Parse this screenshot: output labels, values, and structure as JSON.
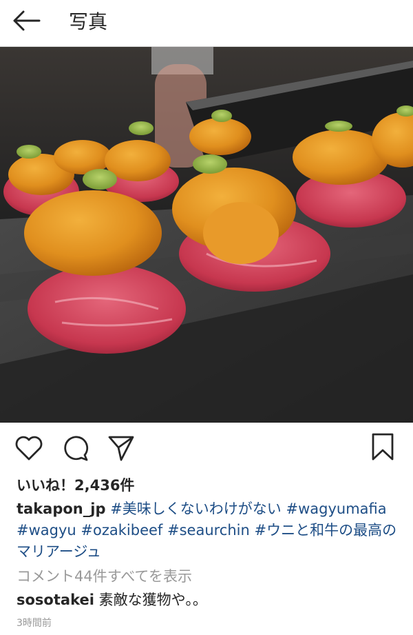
{
  "header": {
    "title": "写真",
    "back_icon": "arrow-left-icon"
  },
  "post": {
    "photo_alt": "和牛とウニの寿司",
    "actions": {
      "like_icon": "heart-icon",
      "comment_icon": "speech-bubble-icon",
      "share_icon": "paper-plane-icon",
      "save_icon": "bookmark-icon"
    },
    "likes_text": "いいね！2,436件",
    "caption": {
      "username": "takapon_jp",
      "hashtags": [
        "#美味しくないわけがない",
        "#wagyumafia",
        "#wagyu",
        "#ozakibeef",
        "#seaurchin",
        "#ウニと和牛の最高のマリアージュ"
      ]
    },
    "view_comments_text": "コメント44件すべてを表示",
    "comments": [
      {
        "username": "sosotakei",
        "text": "素敵な獲物や。。"
      }
    ],
    "timestamp": "3時間前"
  },
  "colors": {
    "hashtag": "#1e4e86",
    "muted": "#999999",
    "text": "#262626"
  }
}
